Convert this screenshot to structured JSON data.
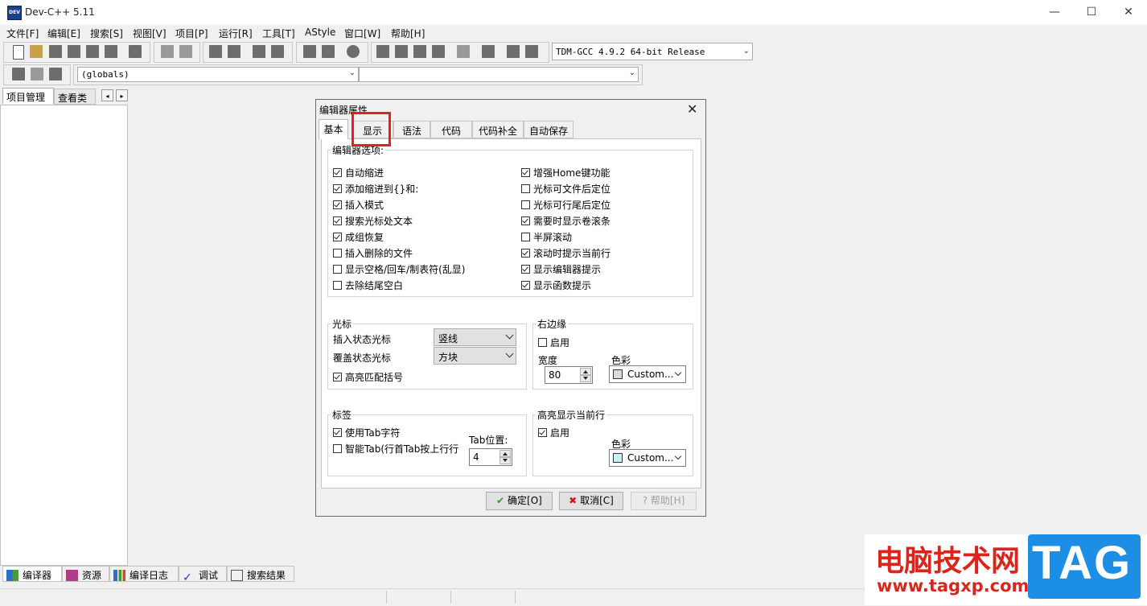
{
  "window": {
    "title": "Dev-C++ 5.11",
    "app_icon_text": "DEV"
  },
  "window_controls": {
    "minimize": "—",
    "maximize": "☐",
    "close": "✕"
  },
  "menu": [
    "文件[F]",
    "编辑[E]",
    "搜索[S]",
    "视图[V]",
    "项目[P]",
    "运行[R]",
    "工具[T]",
    "AStyle",
    "窗口[W]",
    "帮助[H]"
  ],
  "toolbar": {
    "compiler_select": "TDM-GCC 4.9.2 64-bit Release",
    "globals_select": "(globals)",
    "symbol_select": ""
  },
  "left_panel": {
    "tabs": [
      "项目管理",
      "查看类"
    ],
    "nav_left": "◂",
    "nav_right": "▸"
  },
  "bottom_tabs": [
    "编译器",
    "资源",
    "编译日志",
    "调试",
    "搜索结果"
  ],
  "dialog": {
    "title": "编辑器属性",
    "close": "✕",
    "tabs": [
      "基本",
      "显示",
      "语法",
      "代码",
      "代码补全",
      "自动保存"
    ],
    "active_tab": "基本",
    "editor_options": {
      "legend": "编辑器选项:",
      "left": [
        {
          "label": "自动缩进",
          "checked": true
        },
        {
          "label": "添加缩进到{}和:",
          "checked": true
        },
        {
          "label": "插入模式",
          "checked": true
        },
        {
          "label": "搜索光标处文本",
          "checked": true
        },
        {
          "label": "成组恢复",
          "checked": true
        },
        {
          "label": "插入删除的文件",
          "checked": false
        },
        {
          "label": "显示空格/回车/制表符(乱显)",
          "checked": false
        },
        {
          "label": "去除结尾空白",
          "checked": false
        }
      ],
      "right": [
        {
          "label": "增强Home键功能",
          "checked": true
        },
        {
          "label": "光标可文件后定位",
          "checked": false
        },
        {
          "label": "光标可行尾后定位",
          "checked": false
        },
        {
          "label": "需要时显示卷滚条",
          "checked": true
        },
        {
          "label": "半屏滚动",
          "checked": false
        },
        {
          "label": "滚动时提示当前行",
          "checked": true
        },
        {
          "label": "显示编辑器提示",
          "checked": true
        },
        {
          "label": "显示函数提示",
          "checked": true
        }
      ]
    },
    "caret": {
      "legend": "光标",
      "insert_label": "插入状态光标",
      "insert_value": "竖线",
      "overwrite_label": "覆盖状态光标",
      "overwrite_value": "方块",
      "highlight_label": "高亮匹配括号",
      "highlight_checked": true
    },
    "right_margin": {
      "legend": "右边缘",
      "enable_label": "启用",
      "enable_checked": false,
      "width_label": "宽度",
      "width_value": "80",
      "color_label": "色彩",
      "color_value": "Custom...",
      "color_swatch": "#d9d9d9"
    },
    "tabs_group": {
      "legend": "标签",
      "use_tab_label": "使用Tab字符",
      "use_tab_checked": true,
      "smart_tab_label": "智能Tab(行首Tab按上行行",
      "smart_tab_checked": false,
      "tab_size_label": "Tab位置:",
      "tab_size_value": "4"
    },
    "highlight_line": {
      "legend": "高亮显示当前行",
      "enable_label": "启用",
      "enable_checked": true,
      "color_label": "色彩",
      "color_value": "Custom...",
      "color_swatch": "#ccf0ff"
    },
    "buttons": {
      "ok": "确定[O]",
      "cancel": "取消[C]",
      "help": "帮助[H]"
    }
  },
  "watermark": {
    "text": "电脑技术网",
    "url": "www.tagxp.com",
    "badge": "TAG"
  },
  "colors": {
    "highlight_box": "#e3221e",
    "watermark_red": "#d9261c",
    "badge_blue": "#1d8ee6"
  }
}
